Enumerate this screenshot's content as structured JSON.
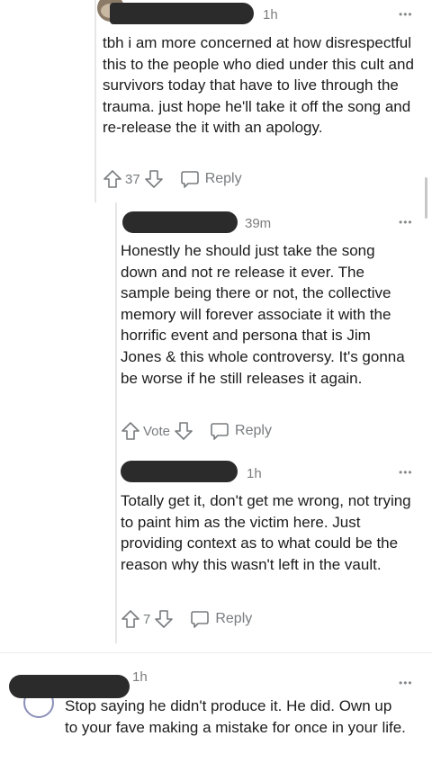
{
  "comments": [
    {
      "time": "1h",
      "body": "tbh i am more concerned at how disrespectful this to the people who died under this cult and survivors today that have to live through the trauma. just hope he'll take it off the song and re-release the it with an apology.",
      "vote_label": "37",
      "reply_label": "Reply"
    },
    {
      "time": "39m",
      "body": "Honestly he should just take the song down and not re release it ever. The sample being there or not, the collective memory will forever associate it with the horrific event and persona that is Jim Jones & this whole controversy. It's gonna be worse if he still releases it again.",
      "vote_label": "Vote",
      "reply_label": "Reply"
    },
    {
      "time": "1h",
      "body": "Totally get it, don't get me wrong, not trying to paint him as the victim here. Just providing context as to what could be the reason why this wasn't left in the vault.",
      "vote_label": "7",
      "reply_label": "Reply"
    },
    {
      "time": "1h",
      "body": "Stop saying he didn't produce it. He did. Own up to your fave making a mistake for once in your life."
    }
  ],
  "icons": {
    "upvote": "arrow-up-outline-icon",
    "downvote": "arrow-down-outline-icon",
    "reply": "speech-bubble-icon",
    "more": "horizontal-ellipsis-icon"
  },
  "colors": {
    "redaction": "#2b2b2b",
    "meta_gray": "#787c7e"
  }
}
